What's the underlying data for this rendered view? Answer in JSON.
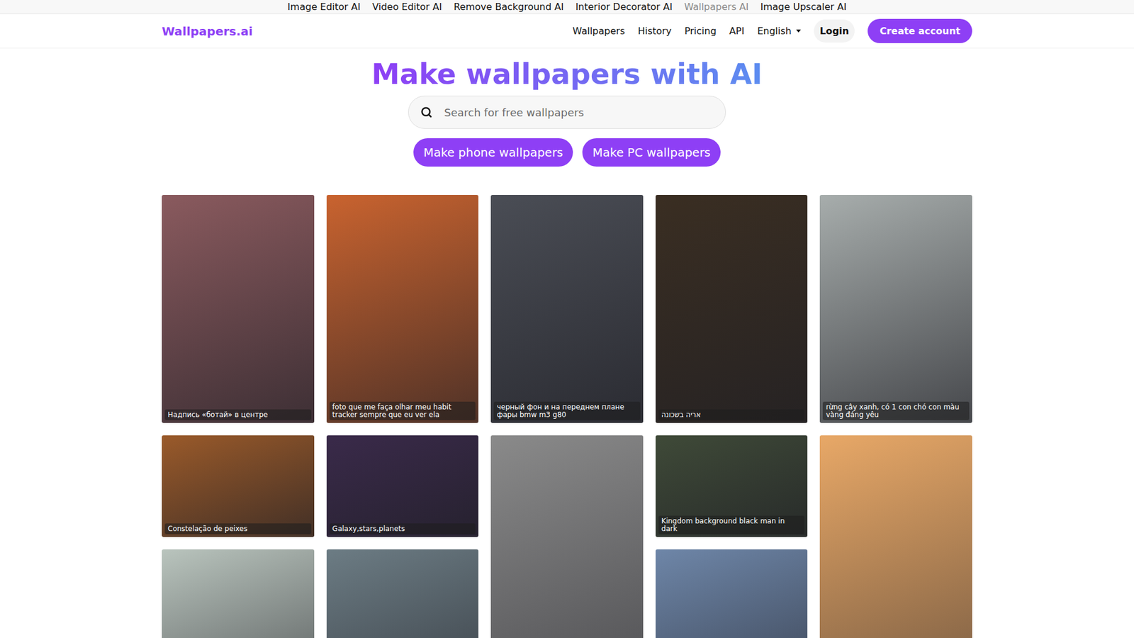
{
  "top_bar": {
    "links": [
      {
        "label": "Image Editor AI",
        "selected": false
      },
      {
        "label": "Video Editor AI",
        "selected": false
      },
      {
        "label": "Remove Background AI",
        "selected": false
      },
      {
        "label": "Interior Decorator AI",
        "selected": false
      },
      {
        "label": "Wallpapers AI",
        "selected": true
      },
      {
        "label": "Image Upscaler AI",
        "selected": false
      }
    ]
  },
  "nav": {
    "logo": "Wallpapers.ai",
    "links": [
      "Wallpapers",
      "History",
      "Pricing",
      "API"
    ],
    "language": "English",
    "login": "Login",
    "create_account": "Create account"
  },
  "hero": {
    "title": "Make wallpapers with AI",
    "search": {
      "placeholder": "Search for free wallpapers"
    },
    "buttons": [
      "Make phone wallpapers",
      "Make PC wallpapers"
    ]
  },
  "gallery": {
    "cards": [
      {
        "caption": "Надпись «ботай» в центре",
        "color": "#8a5a5e"
      },
      {
        "caption": "foto que me faça olhar meu habit tracker sempre que eu ver ela",
        "color": "#c9632f"
      },
      {
        "caption": "черный фон и на переднем плане фары bmw m3 g80",
        "color": "#4a4d55"
      },
      {
        "caption": "אריה בשכונה",
        "color": "#3a2e22"
      },
      {
        "caption": "rừng cây xanh, có 1 con chó con màu vàng đáng yêu",
        "color": "#a7adac"
      },
      {
        "caption": "Constelação de peixes",
        "color": "#9a5a2a"
      },
      {
        "caption": "Galaxy,stars,planets",
        "color": "#3a2a4a"
      },
      {
        "color": "#8a8a8a"
      },
      {
        "caption": "Kingdom background black man in dark",
        "color": "#3f4a38"
      },
      {
        "color": "#e8a867"
      },
      {
        "color": "#b9c4bd"
      },
      {
        "color": "#6c7c84"
      },
      {
        "color": "#6e86a8"
      }
    ]
  }
}
